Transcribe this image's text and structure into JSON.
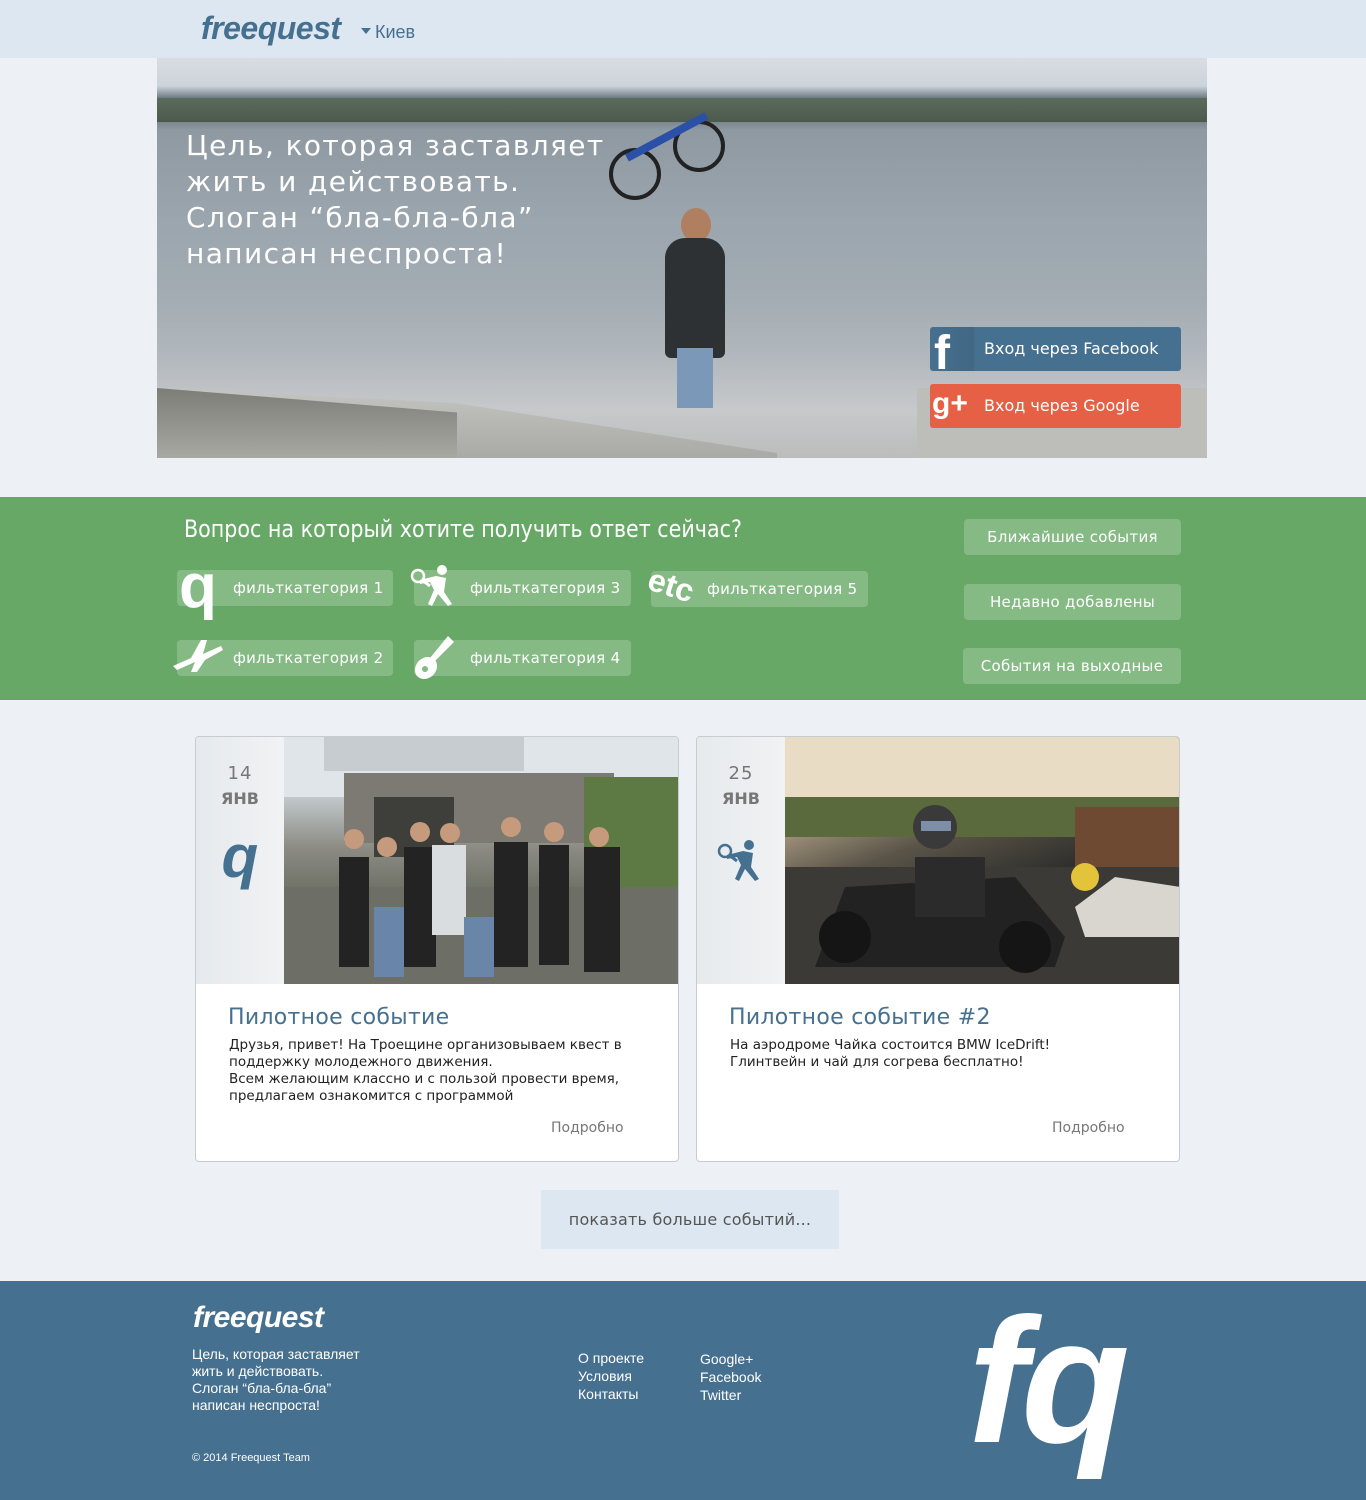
{
  "header": {
    "logo": "freequest",
    "city": "Киев"
  },
  "hero": {
    "tagline": [
      "Цель, которая заставляет",
      "жить и действовать.",
      "Слоган “бла-бла-бла”",
      "написан неспроста!"
    ],
    "facebook_label": "Вход через Facebook",
    "google_label": "Вход через Google",
    "facebook_icon": "facebook-icon",
    "google_icon": "google-plus-icon",
    "facebook_color": "#46708f",
    "google_color": "#e56045"
  },
  "filters": {
    "question": "Вопрос на который хотите получить ответ сейчас?",
    "categories": [
      {
        "label": "фильткатегория 1",
        "icon": "q-icon"
      },
      {
        "label": "фильткатегория 2",
        "icon": "airplane-icon"
      },
      {
        "label": "фильткатегория 3",
        "icon": "tennis-player-icon"
      },
      {
        "label": "фильткатегория 4",
        "icon": "guitar-icon"
      },
      {
        "label": "фильткатегория 5",
        "icon": "etc-icon"
      }
    ],
    "side_buttons": [
      "Ближайшие события",
      "Недавно добавлены",
      "События на выходные"
    ],
    "accent": "#67a866"
  },
  "events": [
    {
      "day": "14",
      "month": "ЯНВ",
      "icon": "q-icon",
      "title": "Пилотное событие",
      "body": [
        "Друзья, привет! На Троещине организовываем квест в поддержку молодежного движения.",
        "Всем желающим классно и с пользой провести время, предлагаем ознакомится с программой"
      ],
      "more": "Подробно"
    },
    {
      "day": "25",
      "month": "ЯНВ",
      "icon": "tennis-player-icon",
      "title": "Пилотное событие #2",
      "body": [
        "На аэродроме Чайка состоится BMW IceDrift!",
        "Глинтвейн и чай для согрева бесплатно!"
      ],
      "more": "Подробно"
    }
  ],
  "show_more": "показать больше событий...",
  "footer": {
    "logo": "freequest",
    "tagline": [
      "Цель, которая заставляет",
      "жить и действовать.",
      "Слоган “бла-бла-бла”",
      "написан неспроста!"
    ],
    "links_col1": [
      "О проекте",
      "Условия",
      "Контакты"
    ],
    "links_col2": [
      "Google+",
      "Facebook",
      "Twitter"
    ],
    "copyright": "© 2014 Freequest Team",
    "big_mark": "fq",
    "background": "#46708f"
  }
}
